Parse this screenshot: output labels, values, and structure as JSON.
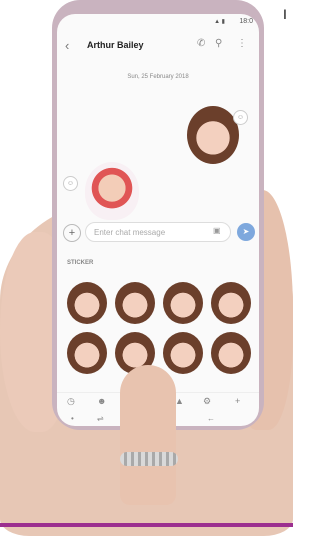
{
  "status": {
    "signal": "▲ ▮",
    "time": "18:0"
  },
  "header": {
    "contact_name": "Arthur Bailey",
    "back_icon": "back-arrow-icon",
    "call_icon": "phone-icon",
    "search_icon": "search-icon",
    "menu_icon": "more-icon"
  },
  "conversation": {
    "date_label": "Sun, 25 February 2018"
  },
  "composer": {
    "placeholder": "Enter chat message"
  },
  "sticker_panel": {
    "title": "STICKER"
  },
  "page": {
    "corner_text": "I"
  }
}
